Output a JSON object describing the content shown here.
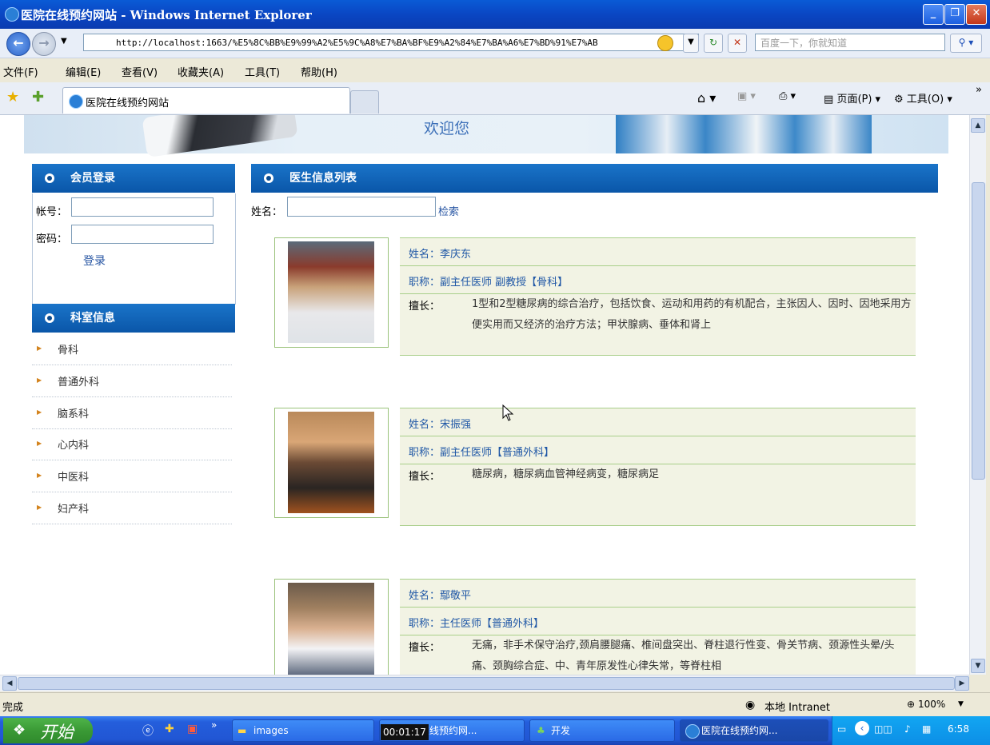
{
  "window": {
    "title": "医院在线预约网站 - Windows Internet Explorer",
    "minimize": "_",
    "restore": "❐",
    "close": "✕"
  },
  "address": {
    "url": "http://localhost:1663/%E5%8C%BB%E9%99%A2%E5%9C%A8%E7%BA%BF%E9%A2%84%E7%BA%A6%E7%BD%91%E7%AB",
    "search_placeholder": "百度一下，你就知道"
  },
  "menu": [
    "文件(F)",
    "编辑(E)",
    "查看(V)",
    "收藏夹(A)",
    "工具(T)",
    "帮助(H)"
  ],
  "tab": {
    "label": "医院在线预约网站"
  },
  "commandbar": {
    "page": "页面(P)",
    "tools": "工具(O)"
  },
  "banner": {
    "welcome": "欢迎您"
  },
  "login": {
    "header": "会员登录",
    "account_label": "帐号：",
    "password_label": "密码：",
    "submit": "登录"
  },
  "departments": {
    "header": "科室信息",
    "items": [
      "骨科",
      "普通外科",
      "脑系科",
      "心内科",
      "中医科",
      "妇产科"
    ]
  },
  "doctors": {
    "header": "医生信息列表",
    "name_label": "姓名：",
    "search_link": "检索",
    "list": [
      {
        "name": "姓名：李庆东",
        "title": "职称：副主任医师 副教授【骨科】",
        "spec_label": "擅长：",
        "spec": "1型和2型糖尿病的综合治疗，包括饮食、运动和用药的有机配合，主张因人、因时、因地采用方便实用而又经济的治疗方法；甲状腺病、垂体和肾上"
      },
      {
        "name": "姓名：宋振强",
        "title": "职称：副主任医师【普通外科】",
        "spec_label": "擅长：",
        "spec": "糖尿病，糖尿病血管神经病变，糖尿病足"
      },
      {
        "name": "姓名：鄢敬平",
        "title": "职称：主任医师【普通外科】",
        "spec_label": "擅长：",
        "spec": "无痛，非手术保守治疗,颈肩腰腿痛、椎间盘突出、脊柱退行性变、骨关节病、颈源性头晕/头痛、颈胸综合症、中、青年原发性心律失常，等脊柱相"
      }
    ]
  },
  "status": {
    "text": "完成",
    "zone": "本地 Intranet",
    "zoom": "100%"
  },
  "taskbar": {
    "start": "开始",
    "tasks": [
      "images",
      "医院在线预约网...",
      "开发",
      "医院在线预约网..."
    ],
    "clock": "6:58",
    "timer": "00:01:17"
  }
}
